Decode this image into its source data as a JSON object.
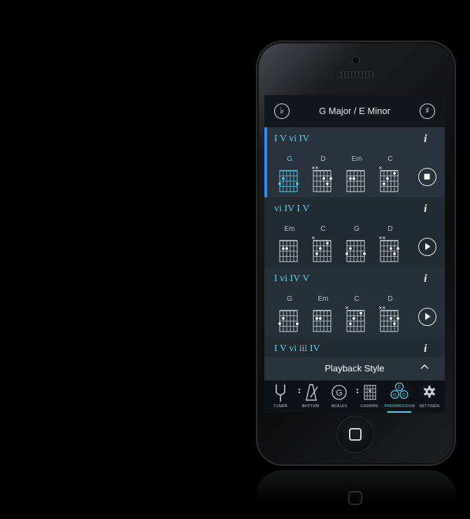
{
  "app": {
    "title": "G Major / E Minor",
    "flat_symbol": "♭",
    "sharp_symbol": "♯",
    "accent_color": "#4fd2ee",
    "highlight_color": "#1e90ff"
  },
  "progressions": [
    {
      "numerals": "I V vi IV",
      "info": "i",
      "state": "playing",
      "chords": [
        {
          "name": "G",
          "active": true
        },
        {
          "name": "D"
        },
        {
          "name": "Em"
        },
        {
          "name": "C"
        }
      ]
    },
    {
      "numerals": "vi IV I V",
      "info": "i",
      "state": "stopped",
      "chords": [
        {
          "name": "Em"
        },
        {
          "name": "C"
        },
        {
          "name": "G"
        },
        {
          "name": "D"
        }
      ]
    },
    {
      "numerals": "I vi IV V",
      "info": "i",
      "state": "stopped",
      "chords": [
        {
          "name": "G"
        },
        {
          "name": "Em"
        },
        {
          "name": "C"
        },
        {
          "name": "D"
        }
      ]
    },
    {
      "numerals": "I V vi iii IV",
      "info": "i",
      "state": "stopped",
      "chords": []
    }
  ],
  "playback_style": {
    "label": "Playback Style",
    "chevron": "^"
  },
  "tabs": [
    {
      "label": "TUNER",
      "icon": "tuning-fork-icon"
    },
    {
      "label": "RHYTHM",
      "icon": "metronome-icon"
    },
    {
      "label": "SCALES",
      "icon": "scale-g-icon",
      "glyph": "G"
    },
    {
      "label": "CHORDS",
      "icon": "chord-grid-icon"
    },
    {
      "label": "PROGRESSION",
      "icon": "progression-circles-icon",
      "glyphs": [
        "C",
        "G",
        "D"
      ],
      "active": true
    },
    {
      "label": "SETTINGS",
      "icon": "gear-icon"
    }
  ]
}
